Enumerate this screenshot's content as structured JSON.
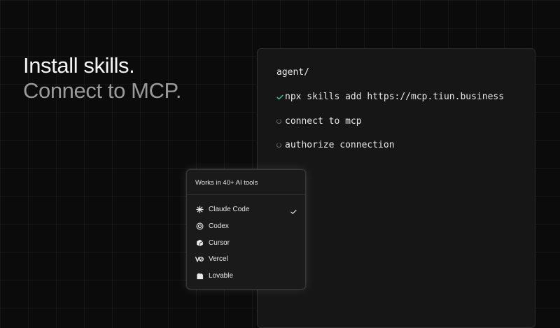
{
  "headline": {
    "line1": "Install skills.",
    "line2": "Connect to MCP."
  },
  "terminal": {
    "prompt": "agent/",
    "steps": [
      {
        "text": "npx skills add https://mcp.tiun.business",
        "status": "done"
      },
      {
        "text": "connect to mcp",
        "status": "pending"
      },
      {
        "text": "authorize connection",
        "status": "pending"
      }
    ]
  },
  "tools_popover": {
    "header": "Works in 40+ AI tools",
    "items": [
      {
        "label": "Claude Code",
        "icon": "claude-icon",
        "selected": true
      },
      {
        "label": "Codex",
        "icon": "codex-icon",
        "selected": false
      },
      {
        "label": "Cursor",
        "icon": "cursor-icon",
        "selected": false
      },
      {
        "label": "Vercel",
        "icon": "vercel-icon",
        "selected": false
      },
      {
        "label": "Lovable",
        "icon": "lovable-icon",
        "selected": false
      }
    ]
  },
  "colors": {
    "background": "#0b0b0b",
    "panel": "#161616",
    "accent_check": "#4cc38a",
    "text_primary": "#f4f4f4",
    "text_muted": "#9a9a9a"
  }
}
